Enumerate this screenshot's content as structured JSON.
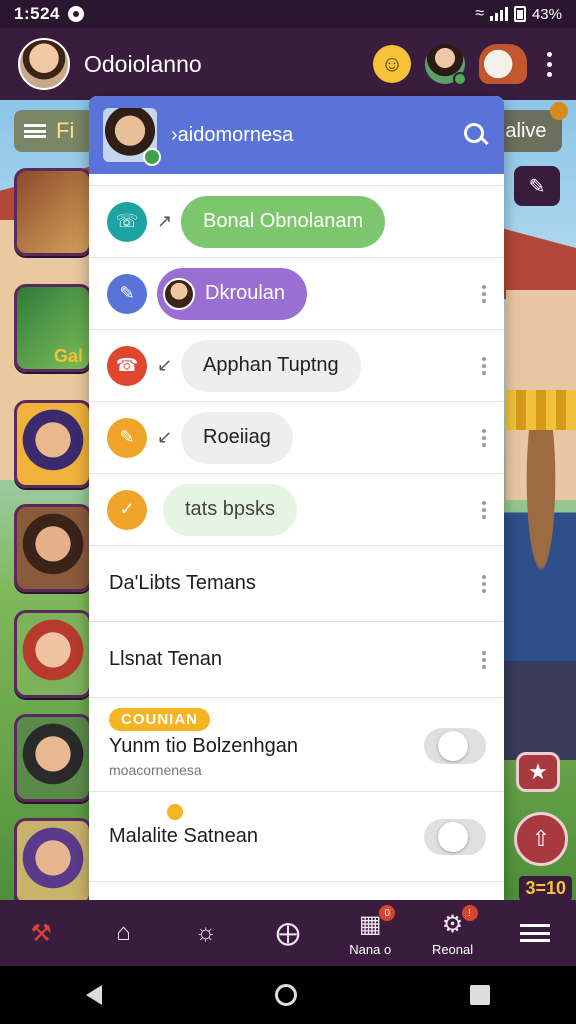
{
  "status": {
    "time": "1:524",
    "battery": "43%"
  },
  "app": {
    "title": "Odoiolanno"
  },
  "background": {
    "left_chip_text": "Fi",
    "right_chip_text": "alive",
    "tile_label": "Gal",
    "corner_label": "3=10"
  },
  "panel": {
    "header_title": "›aidomornesa",
    "rows": [
      {
        "label": "Bonal Obnolanam",
        "icon": "phone-icon",
        "color": "#1ea3a3",
        "pill": "#7cc76d",
        "text_color": "#ffffff"
      },
      {
        "label": "Dkroulan",
        "icon": "edit-icon",
        "color": "#5a73d8",
        "pill": "#9a6fd3",
        "text_color": "#ffffff"
      },
      {
        "label": "Apphan Tuptng",
        "icon": "call-icon",
        "color": "#e0452f",
        "pill": "#eeeeee",
        "text_color": "#222222"
      },
      {
        "label": "Roeiiag",
        "icon": "pencil-icon",
        "color": "#f0a52a",
        "pill": "#eeeeee",
        "text_color": "#222222"
      },
      {
        "label": "tats bpsks",
        "icon": "check-icon",
        "color": "#f0a52a",
        "pill": "#e6f4e2",
        "text_color": "#444444"
      }
    ],
    "plain_rows": [
      {
        "label": "Da'Libts Temans"
      },
      {
        "label": "Llsnat Tenan"
      }
    ],
    "toggle_1": {
      "badge": "COUNIAN",
      "title": "Yunm tio Bolzenhgan",
      "subtitle": "moacornenesa",
      "on": false
    },
    "toggle_2": {
      "title": "Malalite Satnean",
      "on": false
    }
  },
  "bottom_nav": [
    {
      "label": "",
      "icon": "hammer-icon",
      "badge": ""
    },
    {
      "label": "",
      "icon": "home-icon",
      "badge": ""
    },
    {
      "label": "",
      "icon": "chat-icon",
      "badge": ""
    },
    {
      "label": "",
      "icon": "compass-icon",
      "badge": ""
    },
    {
      "label": "Nana o",
      "icon": "notes-icon",
      "badge": "0"
    },
    {
      "label": "Reonal",
      "icon": "gear-icon",
      "badge": "!"
    },
    {
      "label": "",
      "icon": "menu-icon",
      "badge": ""
    }
  ]
}
